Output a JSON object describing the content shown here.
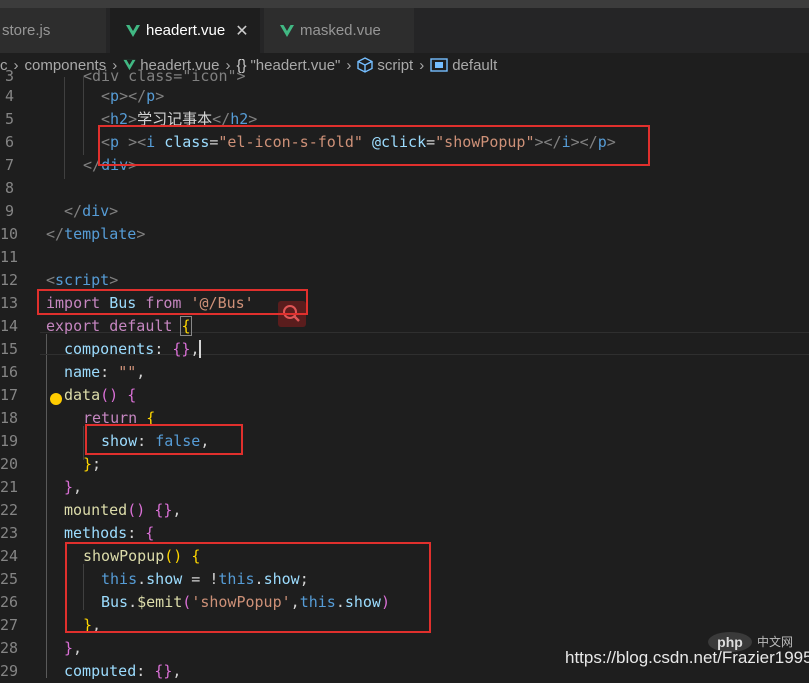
{
  "tabs": [
    {
      "label": "store.js",
      "active": false
    },
    {
      "label": "headert.vue",
      "active": true,
      "close": "✕"
    },
    {
      "label": "masked.vue",
      "active": false
    }
  ],
  "breadcrumb": {
    "items": [
      "components",
      "headert.vue",
      "\"headert.vue\"",
      "script",
      "default"
    ],
    "prefix": "c",
    "separator": "›"
  },
  "line_numbers": [
    "3",
    "4",
    "5",
    "6",
    "7",
    "8",
    "9",
    "10",
    "11",
    "12",
    "13",
    "14",
    "15",
    "16",
    "17",
    "18",
    "19",
    "20",
    "21",
    "22",
    "23",
    "24",
    "25",
    "26",
    "27",
    "28",
    "29"
  ],
  "code": {
    "l3": "<div class=\"icon\">",
    "l4_tag": "p",
    "l5_tag": "h2",
    "l5_text": "学习记事本",
    "l6_p": "p",
    "l6_i": "i",
    "l6_class_attr": "class",
    "l6_class_val": "\"el-icon-s-fold\"",
    "l6_click_attr": "@click",
    "l6_click_val": "\"showPopup\"",
    "l7_tag": "div",
    "l9_tag": "div",
    "l10_tag": "template",
    "l12_tag": "script",
    "l13_import": "import",
    "l13_bus": "Bus",
    "l13_from": "from",
    "l13_path": "'@/Bus'",
    "l14_export": "export",
    "l14_default": "default",
    "l15_key": "components",
    "l16_key": "name",
    "l16_val": "\"\"",
    "l17_fn": "data",
    "l18_return": "return",
    "l19_key": "show",
    "l19_val": "false",
    "l22_fn": "mounted",
    "l23_key": "methods",
    "l24_fn": "showPopup",
    "l25_this1": "this",
    "l25_prop1": "show",
    "l25_this2": "this",
    "l25_prop2": "show",
    "l26_bus": "Bus",
    "l26_emit": "$emit",
    "l26_str": "'showPopup'",
    "l26_this": "this",
    "l26_prop": "show",
    "l29_key": "computed"
  },
  "watermark": "https://blog.csdn.net/Frazier1995",
  "php_logo": "php",
  "cn_logo": "中文网",
  "colors": {
    "highlight_box": "#e0302d",
    "vue_icon": "#41b883"
  }
}
